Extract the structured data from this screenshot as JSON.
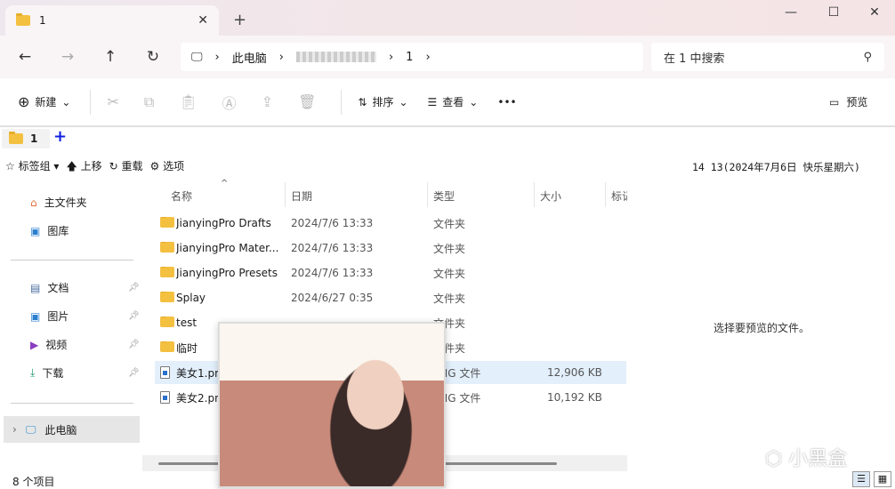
{
  "window": {
    "tab_title": "1",
    "new_tab": "+",
    "minimize": "—",
    "maximize": "☐",
    "close": "✕",
    "tab_close": "✕"
  },
  "nav": {
    "back": "←",
    "forward": "→",
    "up": "↑",
    "refresh": "↻"
  },
  "address": {
    "computer": "此电脑",
    "current": "1",
    "sep": "›"
  },
  "search": {
    "placeholder": "在 1 中搜索",
    "icon": "search-icon"
  },
  "toolbar": {
    "new": "新建",
    "sort": "排序",
    "view": "查看",
    "more": "•••",
    "preview": "预览"
  },
  "quicktabs": {
    "tab1": "1",
    "add": "+"
  },
  "bookmarks": {
    "items": [
      "标签组",
      "上移",
      "重载",
      "选项"
    ]
  },
  "clock": "14 13(2024年7月6日 快乐星期六)",
  "sidebar": {
    "home": "主文件夹",
    "gallery": "图库",
    "pinned": [
      "文档",
      "图片",
      "视频",
      "下载"
    ],
    "pc": "此电脑"
  },
  "columns": [
    "名称",
    "日期",
    "类型",
    "大小",
    "标记"
  ],
  "files": [
    {
      "name": "JianyingPro Drafts",
      "date": "2024/7/6 13:33",
      "type": "文件夹",
      "size": ""
    },
    {
      "name": "JianyingPro Mater...",
      "date": "2024/7/6 13:33",
      "type": "文件夹",
      "size": ""
    },
    {
      "name": "JianyingPro Presets",
      "date": "2024/7/6 13:33",
      "type": "文件夹",
      "size": ""
    },
    {
      "name": "Splay",
      "date": "2024/6/27 0:35",
      "type": "文件夹",
      "size": ""
    },
    {
      "name": "test",
      "date": "",
      "type": "文件夹",
      "size": ""
    },
    {
      "name": "临时",
      "date": "",
      "type": "文件夹",
      "size": ""
    },
    {
      "name": "美女1.png",
      "date": "",
      "type": "PNG 文件",
      "size": "12,906 KB"
    },
    {
      "name": "美女2.png",
      "date": "",
      "type": "PNG 文件",
      "size": "10,192 KB"
    }
  ],
  "preview_pane": "选择要预览的文件。",
  "status": "8 个项目",
  "watermark": "小黑盒"
}
